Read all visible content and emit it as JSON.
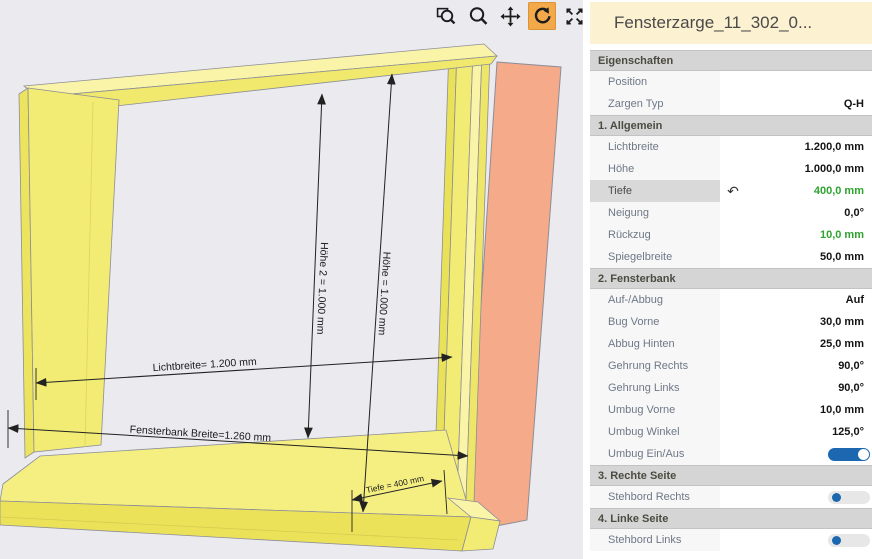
{
  "viewport": {
    "toolbar": [
      {
        "name": "zoom-selection",
        "active": false
      },
      {
        "name": "zoom",
        "active": false
      },
      {
        "name": "pan",
        "active": false
      },
      {
        "name": "rotate",
        "active": true
      },
      {
        "name": "fit-view",
        "active": false
      }
    ],
    "dimensions": {
      "hoehe2": "Höhe 2 = 1.000 mm",
      "hoehe": "Höhe = 1.000 mm",
      "lichtbreite": "Lichtbreite= 1.200 mm",
      "fensterbank": "Fensterbank Breite=1.260 mm",
      "tiefe": "Tiefe = 400 mm"
    },
    "colors": {
      "background": "#eaeaef",
      "frame_yellow": "#f2eb74",
      "panel_salmon": "#f5aa8a",
      "accent_orange": "#f3a84a"
    }
  },
  "panel": {
    "title": "Fensterzarge_11_302_0...",
    "colors": {
      "toggle_blue": "#1b67b0",
      "modified_green": "#2fa32f"
    },
    "sections": [
      {
        "header": "Eigenschaften",
        "rows": [
          {
            "label": "Position",
            "value": ""
          },
          {
            "label": "Zargen Typ",
            "value": "Q-H"
          }
        ]
      },
      {
        "header": "1. Allgemein",
        "rows": [
          {
            "label": "Lichtbreite",
            "value": "1.200,0 mm"
          },
          {
            "label": "Höhe",
            "value": "1.000,0 mm"
          },
          {
            "label": "Tiefe",
            "value": "400,0 mm",
            "modified": true,
            "selected": true,
            "undo": true
          },
          {
            "label": "Neigung",
            "value": "0,0°"
          },
          {
            "label": "Rückzug",
            "value": "10,0 mm",
            "modified": true
          },
          {
            "label": "Spiegelbreite",
            "value": "50,0 mm"
          }
        ]
      },
      {
        "header": "2. Fensterbank",
        "rows": [
          {
            "label": "Auf-/Abbug",
            "value": "Auf"
          },
          {
            "label": "Bug Vorne",
            "value": "30,0 mm"
          },
          {
            "label": "Abbug Hinten",
            "value": "25,0 mm"
          },
          {
            "label": "Gehrung Rechts",
            "value": "90,0°"
          },
          {
            "label": "Gehrung Links",
            "value": "90,0°"
          },
          {
            "label": "Umbug Vorne",
            "value": "10,0 mm"
          },
          {
            "label": "Umbug Winkel",
            "value": "125,0°"
          },
          {
            "label": "Umbug Ein/Aus",
            "toggle": "on"
          }
        ]
      },
      {
        "header": "3. Rechte Seite",
        "rows": [
          {
            "label": "Stehbord Rechts",
            "toggle": "off"
          }
        ]
      },
      {
        "header": "4. Linke Seite",
        "rows": [
          {
            "label": "Stehbord Links",
            "toggle": "off"
          }
        ]
      }
    ]
  }
}
